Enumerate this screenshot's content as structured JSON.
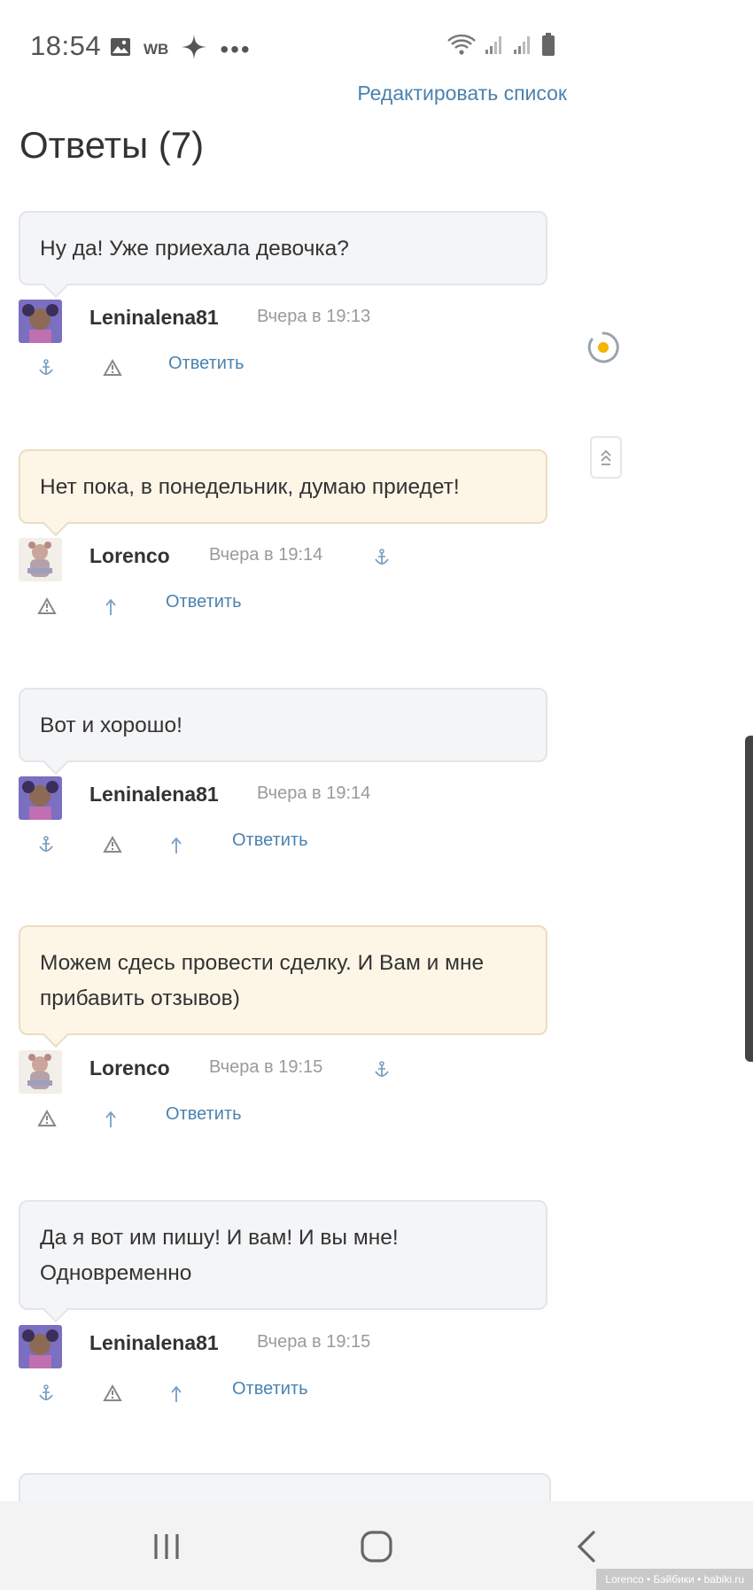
{
  "status_bar": {
    "time": "18:54",
    "label_wb": "WB",
    "icons": [
      "image-icon",
      "wb-icon",
      "sparkle-icon",
      "more-dots-icon",
      "wifi-icon",
      "signal-icon",
      "signal-icon",
      "battery-icon"
    ]
  },
  "header": {
    "edit_link": "Редактировать список",
    "title": "Ответы (7)"
  },
  "comments": [
    {
      "text": "Ну да! Уже приехала девочка?",
      "author": "Leninalena81",
      "time": "Вчера в 19:13",
      "reply": "Ответить",
      "style": "gray"
    },
    {
      "text": "Нет пока, в понедельник, думаю приедет!",
      "author": "Lorenco",
      "time": "Вчера в 19:14",
      "reply": "Ответить",
      "style": "beige"
    },
    {
      "text": "Вот и хорошо!",
      "author": "Leninalena81",
      "time": "Вчера в 19:14",
      "reply": "Ответить",
      "style": "gray"
    },
    {
      "text": "Можем сдесь провести сделку. И Вам и мне прибавить отзывов)",
      "author": "Lorenco",
      "time": "Вчера в 19:15",
      "reply": "Ответить",
      "style": "beige"
    },
    {
      "text": "Да я вот им пишу! И вам! И вы мне! Одновременно",
      "author": "Leninalena81",
      "time": "Вчера в 19:15",
      "reply": "Ответить",
      "style": "gray"
    }
  ],
  "watermark": "Lorenco • Бэйбики • babiki.ru",
  "colors": {
    "link": "#4a82b0",
    "bubble_gray": "#f4f5f7",
    "bubble_beige": "#fdf6e7",
    "loader_accent": "#f5b400"
  }
}
